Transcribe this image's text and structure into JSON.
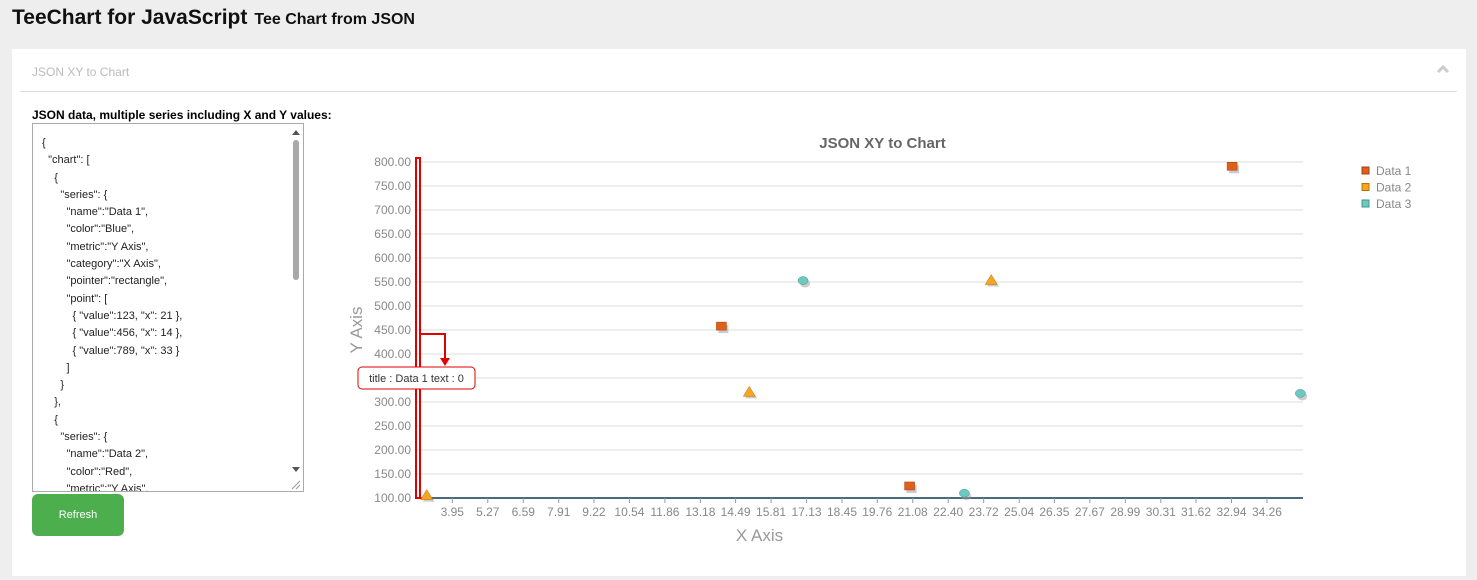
{
  "page": {
    "title": "TeeChart for JavaScript",
    "subtitle": "Tee Chart from JSON"
  },
  "panel": {
    "title": "JSON XY to Chart",
    "collapse_icon": "chevron-up-icon"
  },
  "json_input": {
    "label": "JSON data, multiple series including X and Y values:",
    "lines": [
      "{",
      "  \"chart\": [",
      "    {",
      "      \"series\": {",
      "        \"name\":\"Data 1\",",
      "        \"color\":\"Blue\",",
      "        \"metric\":\"Y Axis\",",
      "        \"category\":\"X Axis\",",
      "        \"pointer\":\"rectangle\",",
      "        \"point\": [",
      "          { \"value\":123, \"x\": 21 },",
      "          { \"value\":456, \"x\": 14 },",
      "          { \"value\":789, \"x\": 33 }",
      "        ]",
      "      }",
      "    },",
      "    {",
      "      \"series\": {",
      "        \"name\":\"Data 2\",",
      "        \"color\":\"Red\",",
      "        \"metric\":\"Y Axis\","
    ]
  },
  "refresh_label": "Refresh",
  "colors": {
    "data1": "#e0601a",
    "data2": "#f5a623",
    "data3": "#6fc8c0",
    "button": "#4cae4c",
    "marker": "#e00000"
  },
  "chart_data": {
    "type": "scatter",
    "title": "JSON XY to Chart",
    "xlabel": "X Axis",
    "ylabel": "Y Axis",
    "xlim": [
      2.6,
      35.6
    ],
    "ylim": [
      100,
      800
    ],
    "y_ticks": [
      "100.00",
      "150.00",
      "200.00",
      "250.00",
      "300.00",
      "350.00",
      "400.00",
      "450.00",
      "500.00",
      "550.00",
      "600.00",
      "650.00",
      "700.00",
      "750.00",
      "800.00"
    ],
    "x_ticks": [
      "3.95",
      "5.27",
      "6.59",
      "7.91",
      "9.22",
      "10.54",
      "11.86",
      "13.18",
      "14.49",
      "15.81",
      "17.13",
      "18.45",
      "19.76",
      "21.08",
      "22.40",
      "23.72",
      "25.04",
      "26.35",
      "27.67",
      "28.99",
      "30.31",
      "31.62",
      "32.94",
      "34.26"
    ],
    "grid": true,
    "legend": "top-right",
    "series": [
      {
        "name": "Data 1",
        "pointer": "rectangle",
        "color": "#e0601a",
        "points": [
          {
            "x": 21,
            "y": 123
          },
          {
            "x": 14,
            "y": 456
          },
          {
            "x": 33,
            "y": 789
          }
        ]
      },
      {
        "name": "Data 2",
        "pointer": "triangle",
        "color": "#f5a623",
        "points": [
          {
            "x": 3,
            "y": 105
          },
          {
            "x": 15,
            "y": 320
          },
          {
            "x": 24,
            "y": 553
          }
        ]
      },
      {
        "name": "Data 3",
        "pointer": "ellipse",
        "color": "#6fc8c0",
        "points": [
          {
            "x": 17,
            "y": 553
          },
          {
            "x": 23,
            "y": 110
          },
          {
            "x": 35.5,
            "y": 318
          }
        ]
      }
    ],
    "tooltip": "title : Data 1 text : 0"
  }
}
